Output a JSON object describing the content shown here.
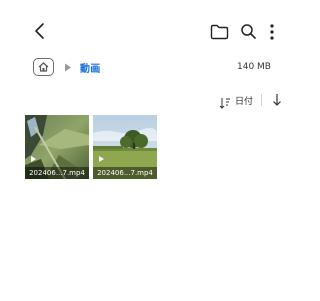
{
  "toolbar": {
    "back_icon": "chevron-left-icon",
    "folder_icon": "folder-icon",
    "search_icon": "search-icon",
    "more_icon": "more-vert-icon"
  },
  "breadcrumb": {
    "home_icon": "home-icon",
    "separator_icon": "triangle-right-icon",
    "current": "動画",
    "size": "140 MB"
  },
  "sort": {
    "label": "日付",
    "icon": "sort-icon",
    "direction_icon": "arrow-down-icon"
  },
  "files": [
    {
      "name": "202406...7.mp4",
      "type": "video"
    },
    {
      "name": "202406...7.mp4",
      "type": "video"
    }
  ],
  "colors": {
    "accent": "#1b6fd8",
    "icon": "#222222"
  }
}
